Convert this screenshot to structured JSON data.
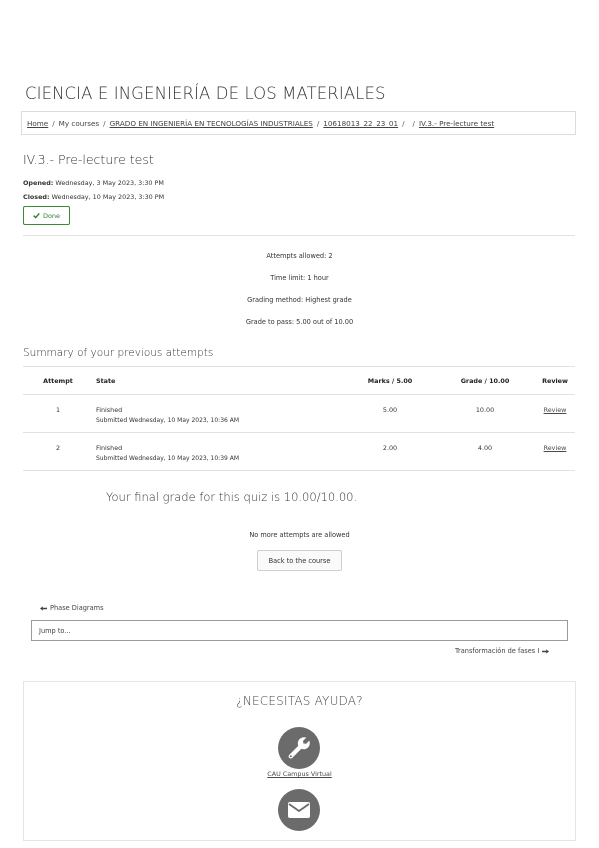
{
  "course": {
    "title": "CIENCIA E INGENIERÍA DE LOS MATERIALES"
  },
  "breadcrumb": {
    "items": [
      "Home",
      "My courses",
      "GRADO EN INGENIERÍA EN TECNOLOGÍAS INDUSTRIALES",
      "10618013_22_23_01",
      "",
      "IV.3.- Pre-lecture test"
    ],
    "separator": "/"
  },
  "quiz": {
    "title": "IV.3.- Pre-lecture test",
    "opened_label": "Opened:",
    "opened_value": "Wednesday, 3 May 2023, 3:30 PM",
    "closed_label": "Closed:",
    "closed_value": "Wednesday, 10 May 2023, 3:30 PM",
    "done_label": "Done",
    "done_icon": "check-icon"
  },
  "info": [
    "Attempts allowed: 2",
    "Time limit: 1 hour",
    "Grading method: Highest grade",
    "Grade to pass: 5.00 out of 10.00"
  ],
  "summary": {
    "heading": "Summary of your previous attempts",
    "columns": [
      "Attempt",
      "State",
      "Marks / 5.00",
      "Grade / 10.00",
      "Review"
    ],
    "rows": [
      {
        "attempt": "1",
        "state": "Finished",
        "submitted": "Submitted Wednesday, 10 May 2023, 10:36 AM",
        "marks": "5.00",
        "grade": "10.00",
        "review": "Review"
      },
      {
        "attempt": "2",
        "state": "Finished",
        "submitted": "Submitted Wednesday, 10 May 2023, 10:39 AM",
        "marks": "2.00",
        "grade": "4.00",
        "review": "Review"
      }
    ]
  },
  "final_grade": "Your final grade for this quiz is 10.00/10.00.",
  "no_more_attempts": "No more attempts are allowed",
  "back_button": "Back to the course",
  "navigation": {
    "prev_label": "Phase Diagrams",
    "prev_icon": "arrow-left-icon",
    "jump_placeholder": "Jump to...",
    "next_label": "Transformación de fases I",
    "next_icon": "arrow-right-icon"
  },
  "help": {
    "title": "¿NECESITAS AYUDA?",
    "cau_link": "CAU Campus Virtual",
    "icons": [
      "wrench-icon",
      "envelope-icon"
    ]
  },
  "colors": {
    "done_green": "#2e7d32",
    "icon_gray": "#6b6b6b",
    "border": "#e2e2e2"
  }
}
